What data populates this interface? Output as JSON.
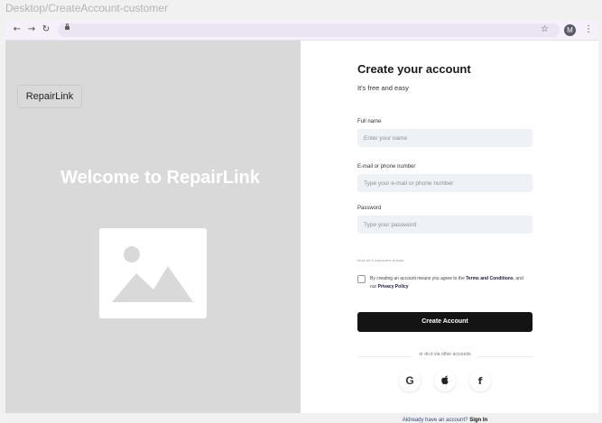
{
  "frame_label": "Desktop/CreateAccount-customer",
  "browser": {
    "avatar_initial": "M"
  },
  "left": {
    "brand": "RepairLink",
    "welcome": "Welcome to RepairLink"
  },
  "form": {
    "title": "Create your account",
    "subtitle": "It's free and easy",
    "fullname_label": "Full name",
    "fullname_placeholder": "Enter your name",
    "email_label": "E-mail or phone number",
    "email_placeholder": "Type your e-mail or phone number",
    "password_label": "Password",
    "password_placeholder": "Type your password",
    "password_hint": "Must be 8 characters at least",
    "terms_prefix": "By creating an account means you agree to the ",
    "terms_link": "Terms and Conditions",
    "terms_middle": ", and our ",
    "privacy_link": "Privacy Policy",
    "submit_label": "Create Account",
    "divider_text": "or do it via other accounts",
    "signin_prompt": "Aldready have an account?",
    "signin_link": "Sign In"
  },
  "icons": {
    "back": "arrow-left-icon",
    "forward": "arrow-right-icon",
    "reload": "reload-icon",
    "star": "star-icon",
    "menu": "kebab-icon",
    "google": "google-icon",
    "apple": "apple-icon",
    "facebook": "facebook-icon"
  },
  "colors": {
    "accent_button": "#141414",
    "input_bg": "#eef1f5",
    "left_panel": "#d9d9d9"
  }
}
